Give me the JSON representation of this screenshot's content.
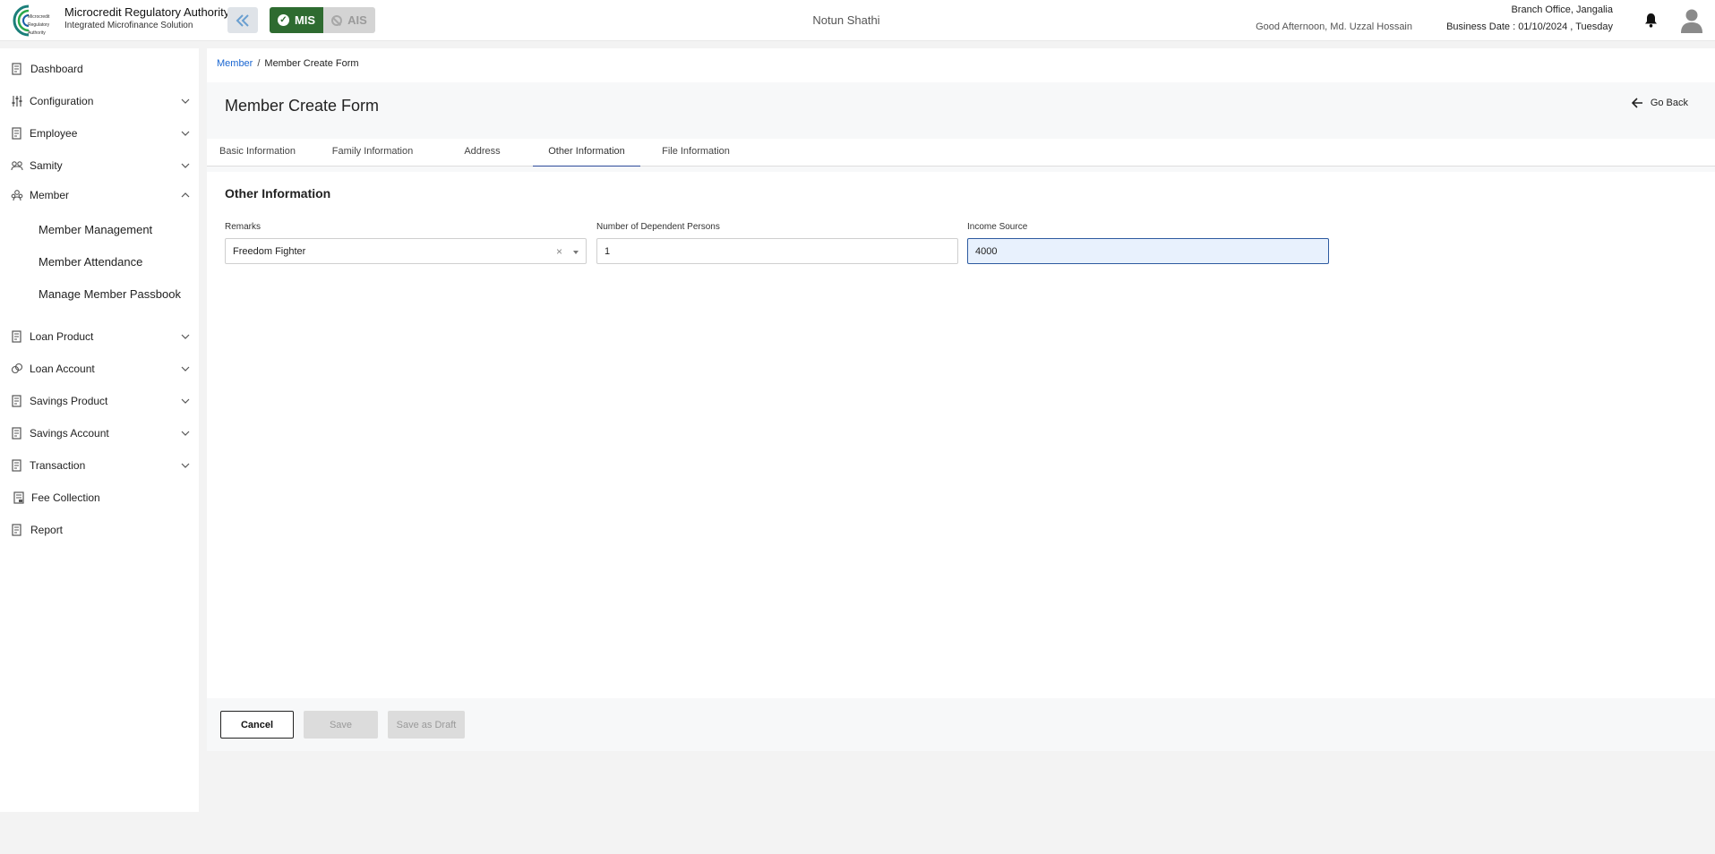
{
  "header": {
    "brand_title": "Microcredit Regulatory Authority",
    "brand_subtitle": "Integrated Microfinance Solution",
    "logo_text": [
      "Microcredit",
      "Regulatory",
      "Authority"
    ],
    "mode_mis": "MIS",
    "mode_ais": "AIS",
    "org_name": "Notun Shathi",
    "greeting": "Good Afternoon, Md. Uzzal Hossain",
    "branch": "Branch Office, Jangalia",
    "business_date": "Business Date : 01/10/2024 , Tuesday",
    "icons": [
      "double-chevron-left-icon",
      "check-circle-icon",
      "ban-icon",
      "bell-icon",
      "user-avatar-icon"
    ],
    "colors": {
      "mis_active": "#2e6b30",
      "ais_inactive": "#d4d4d4"
    }
  },
  "sidebar": {
    "items": [
      {
        "label": "Dashboard",
        "icon": "dashboard-icon",
        "expandable": false
      },
      {
        "label": "Configuration",
        "icon": "sliders-icon",
        "expandable": true
      },
      {
        "label": "Employee",
        "icon": "document-icon",
        "expandable": true
      },
      {
        "label": "Samity",
        "icon": "group-icon",
        "expandable": true
      },
      {
        "label": "Member",
        "icon": "members-icon",
        "expandable": true,
        "expanded": true
      },
      {
        "label": "Loan Product",
        "icon": "document-icon",
        "expandable": true
      },
      {
        "label": "Loan Account",
        "icon": "coins-icon",
        "expandable": true
      },
      {
        "label": "Savings Product",
        "icon": "document-icon",
        "expandable": true
      },
      {
        "label": "Savings Account",
        "icon": "document-icon",
        "expandable": true
      },
      {
        "label": "Transaction",
        "icon": "document-icon",
        "expandable": true
      },
      {
        "label": "Fee Collection",
        "icon": "receipt-icon",
        "expandable": false
      },
      {
        "label": "Report",
        "icon": "document-icon",
        "expandable": false
      }
    ],
    "member_subitems": [
      "Member Management",
      "Member Attendance",
      "Manage Member Passbook"
    ]
  },
  "breadcrumb": {
    "parent": "Member",
    "separator": "/",
    "current": "Member Create Form"
  },
  "page": {
    "title": "Member Create Form",
    "go_back": "Go Back"
  },
  "tabs": [
    {
      "label": "Basic Information",
      "active": false
    },
    {
      "label": "Family Information",
      "active": false
    },
    {
      "label": "Address",
      "active": false
    },
    {
      "label": "Other Information",
      "active": true
    },
    {
      "label": "File Information",
      "active": false
    }
  ],
  "form": {
    "section_title": "Other Information",
    "remarks": {
      "label": "Remarks",
      "value": "Freedom Fighter",
      "clear": "×"
    },
    "dependents": {
      "label": "Number of Dependent Persons",
      "value": "1"
    },
    "income_source": {
      "label": "Income Source",
      "value": "4000"
    }
  },
  "footer": {
    "cancel": "Cancel",
    "save": "Save",
    "save_draft": "Save as Draft"
  }
}
